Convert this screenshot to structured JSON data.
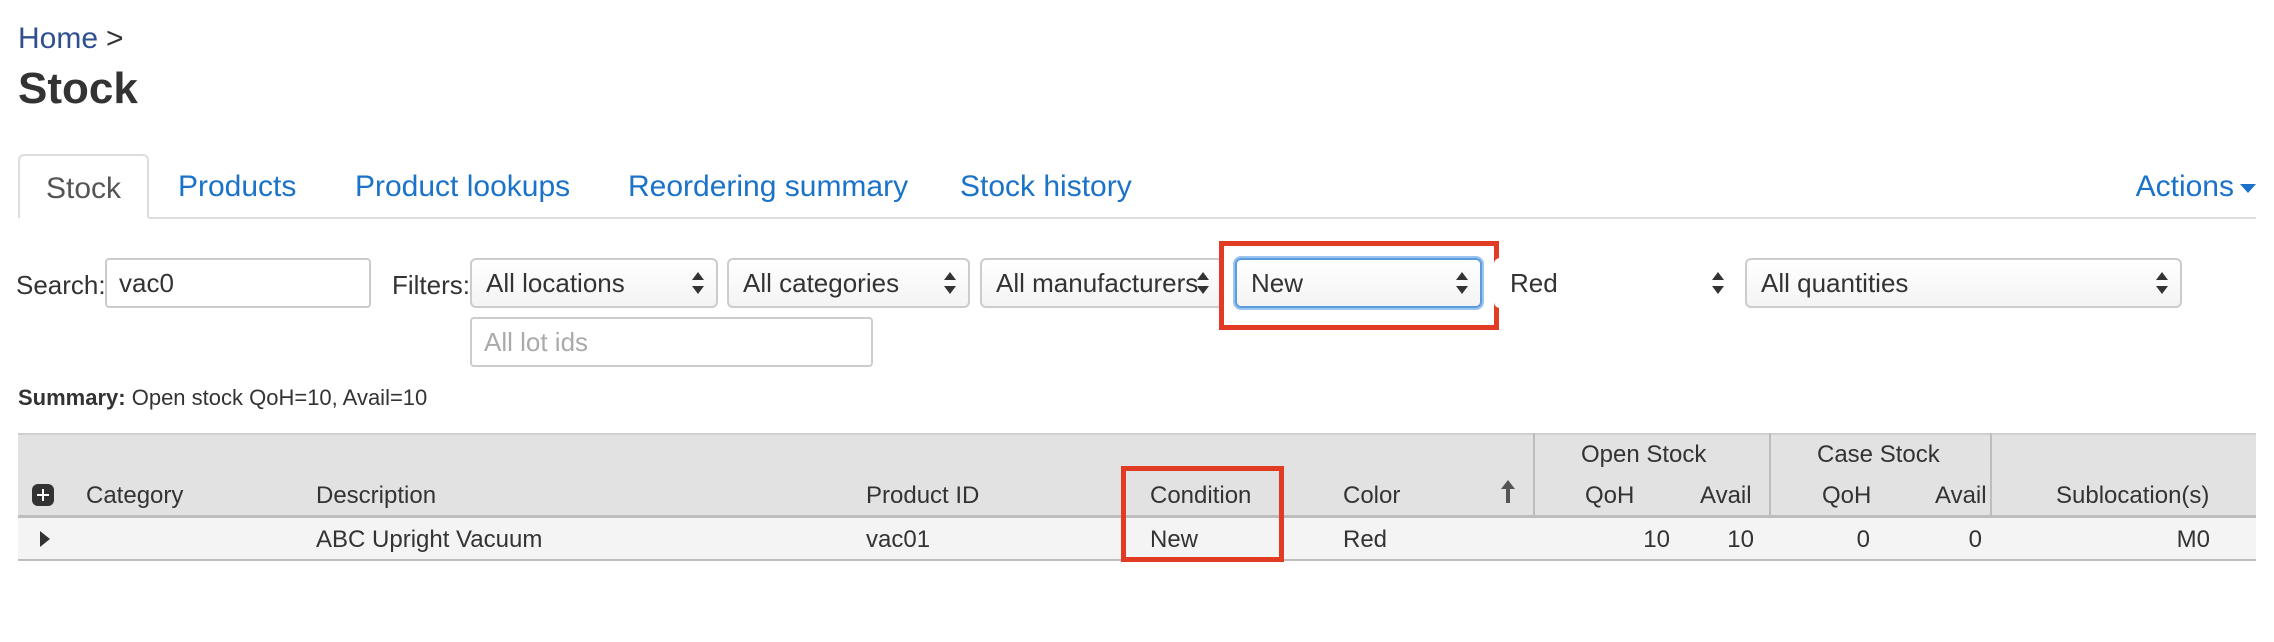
{
  "breadcrumb": {
    "home": "Home",
    "separator": ">"
  },
  "page_title": "Stock",
  "tabs": [
    {
      "label": "Stock",
      "active": true
    },
    {
      "label": "Products"
    },
    {
      "label": "Product lookups"
    },
    {
      "label": "Reordering summary"
    },
    {
      "label": "Stock history"
    }
  ],
  "actions_label": "Actions",
  "search": {
    "label": "Search:",
    "value": "vac0"
  },
  "filters": {
    "label": "Filters:",
    "location": "All locations",
    "category": "All categories",
    "manufacturer": "All manufacturers",
    "condition": "New",
    "color": "Red",
    "quantity": "All quantities",
    "lot_placeholder": "All lot ids"
  },
  "summary": {
    "label": "Summary:",
    "text": "Open stock QoH=10, Avail=10"
  },
  "table": {
    "group_open": "Open Stock",
    "group_case": "Case Stock",
    "headers": {
      "category": "Category",
      "description": "Description",
      "product_id": "Product ID",
      "condition": "Condition",
      "color": "Color",
      "open_qoh": "QoH",
      "open_avail": "Avail",
      "case_qoh": "QoH",
      "case_avail": "Avail",
      "sublocations": "Sublocation(s)"
    },
    "rows": [
      {
        "category": "",
        "description": "ABC Upright Vacuum",
        "product_id": "vac01",
        "condition": "New",
        "color": "Red",
        "open_qoh": "10",
        "open_avail": "10",
        "case_qoh": "0",
        "case_avail": "0",
        "sublocations": "M0"
      }
    ]
  },
  "colors": {
    "link": "#1a73c8",
    "highlight": "#e23b24",
    "header_bg": "#e2e2e2"
  }
}
